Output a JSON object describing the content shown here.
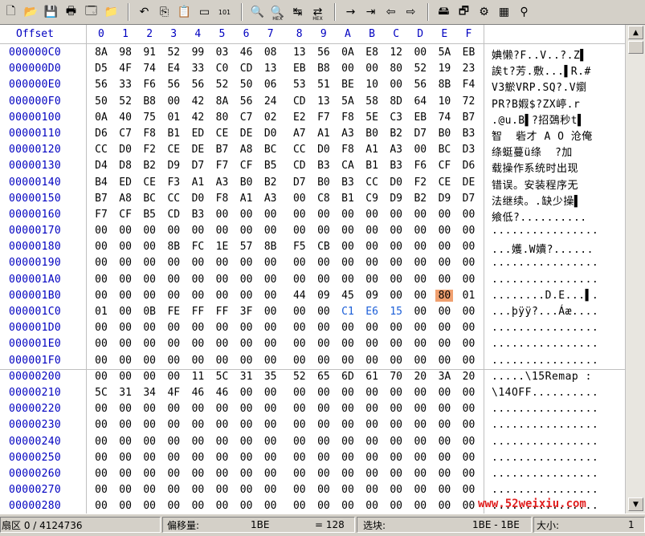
{
  "toolbar": {
    "buttons": [
      {
        "icon": "new-file-icon",
        "glyph": "🗋"
      },
      {
        "icon": "open-folder-icon",
        "glyph": "📂"
      },
      {
        "icon": "save-icon",
        "glyph": "💾"
      },
      {
        "icon": "print-icon",
        "glyph": "🖶"
      },
      {
        "icon": "properties-icon",
        "glyph": "🗔"
      },
      {
        "icon": "open-special-icon",
        "glyph": "📁"
      },
      {
        "icon": "undo-icon",
        "glyph": "↶"
      },
      {
        "icon": "copy-icon",
        "glyph": "⎘"
      },
      {
        "icon": "paste-icon",
        "glyph": "📋"
      },
      {
        "icon": "paste-disabled-icon",
        "glyph": "▭"
      },
      {
        "icon": "binary-icon",
        "glyph": "101"
      },
      {
        "icon": "find-icon",
        "glyph": "🔍"
      },
      {
        "icon": "find-hex-icon",
        "glyph": "🔍",
        "sub": "HEX"
      },
      {
        "icon": "replace-icon",
        "glyph": "↹"
      },
      {
        "icon": "replace-hex-icon",
        "glyph": "⇄",
        "sub": "HEX"
      },
      {
        "icon": "goto-icon",
        "glyph": "→"
      },
      {
        "icon": "goto-offset-icon",
        "glyph": "⇥"
      },
      {
        "icon": "back-icon",
        "glyph": "⇦"
      },
      {
        "icon": "forward-icon",
        "glyph": "⇨"
      },
      {
        "icon": "disk-icon",
        "glyph": "🖴"
      },
      {
        "icon": "windows-icon",
        "glyph": "🗗"
      },
      {
        "icon": "tools-icon",
        "glyph": "⚙"
      },
      {
        "icon": "calculator-icon",
        "glyph": "▦"
      },
      {
        "icon": "search-icon",
        "glyph": "⚲"
      }
    ]
  },
  "header": {
    "offset_label": "Offset",
    "columns": [
      "0",
      "1",
      "2",
      "3",
      "4",
      "5",
      "6",
      "7",
      "8",
      "9",
      "A",
      "B",
      "C",
      "D",
      "E",
      "F"
    ]
  },
  "rows": [
    {
      "offset": "000000C0",
      "bytes": [
        "8A",
        "98",
        "91",
        "52",
        "99",
        "03",
        "46",
        "08",
        "13",
        "56",
        "0A",
        "E8",
        "12",
        "00",
        "5A",
        "EB"
      ],
      "ascii": "婰懒?F..V..?.Z▌"
    },
    {
      "offset": "000000D0",
      "bytes": [
        "D5",
        "4F",
        "74",
        "E4",
        "33",
        "C0",
        "CD",
        "13",
        "EB",
        "B8",
        "00",
        "00",
        "80",
        "52",
        "19",
        "23"
      ],
      "ascii": "誒t?芳.敷...▌R.#"
    },
    {
      "offset": "000000E0",
      "bytes": [
        "56",
        "33",
        "F6",
        "56",
        "56",
        "52",
        "50",
        "06",
        "53",
        "51",
        "BE",
        "10",
        "00",
        "56",
        "8B",
        "F4"
      ],
      "ascii": "V3鯲VRP.SQ?.V嬼"
    },
    {
      "offset": "000000F0",
      "bytes": [
        "50",
        "52",
        "B8",
        "00",
        "42",
        "8A",
        "56",
        "24",
        "CD",
        "13",
        "5A",
        "58",
        "8D",
        "64",
        "10",
        "72"
      ],
      "ascii": "PR?B婽$?ZX嵉.r"
    },
    {
      "offset": "00000100",
      "bytes": [
        "0A",
        "40",
        "75",
        "01",
        "42",
        "80",
        "C7",
        "02",
        "E2",
        "F7",
        "F8",
        "5E",
        "C3",
        "EB",
        "74",
        "B7"
      ],
      "ascii": ".@u.B▌?招鵶秒t▌"
    },
    {
      "offset": "00000110",
      "bytes": [
        "D6",
        "C7",
        "F8",
        "B1",
        "ED",
        "CE",
        "DE",
        "D0",
        "A7",
        "A1",
        "A3",
        "B0",
        "B2",
        "D7",
        "B0",
        "B3"
      ],
      "ascii": "智  砦才 A O 沧俺"
    },
    {
      "offset": "00000120",
      "bytes": [
        "CC",
        "D0",
        "F2",
        "CE",
        "DE",
        "B7",
        "A8",
        "BC",
        "CC",
        "D0",
        "F8",
        "A1",
        "A3",
        "00",
        "BC",
        "D3"
      ],
      "ascii": "绦蜓蔓ü绦  ?加"
    },
    {
      "offset": "00000130",
      "bytes": [
        "D4",
        "D8",
        "B2",
        "D9",
        "D7",
        "F7",
        "CF",
        "B5",
        "CD",
        "B3",
        "CA",
        "B1",
        "B3",
        "F6",
        "CF",
        "D6"
      ],
      "ascii": "载操作系统时出现"
    },
    {
      "offset": "00000140",
      "bytes": [
        "B4",
        "ED",
        "CE",
        "F3",
        "A1",
        "A3",
        "B0",
        "B2",
        "D7",
        "B0",
        "B3",
        "CC",
        "D0",
        "F2",
        "CE",
        "DE"
      ],
      "ascii": "错误。安装程序无"
    },
    {
      "offset": "00000150",
      "bytes": [
        "B7",
        "A8",
        "BC",
        "CC",
        "D0",
        "F8",
        "A1",
        "A3",
        "00",
        "C8",
        "B1",
        "C9",
        "D9",
        "B2",
        "D9",
        "D7"
      ],
      "ascii": "法继续。.缺少操▌"
    },
    {
      "offset": "00000160",
      "bytes": [
        "F7",
        "CF",
        "B5",
        "CD",
        "B3",
        "00",
        "00",
        "00",
        "00",
        "00",
        "00",
        "00",
        "00",
        "00",
        "00",
        "00"
      ],
      "ascii": "飨低?.........."
    },
    {
      "offset": "00000170",
      "bytes": [
        "00",
        "00",
        "00",
        "00",
        "00",
        "00",
        "00",
        "00",
        "00",
        "00",
        "00",
        "00",
        "00",
        "00",
        "00",
        "00"
      ],
      "ascii": "................"
    },
    {
      "offset": "00000180",
      "bytes": [
        "00",
        "00",
        "00",
        "8B",
        "FC",
        "1E",
        "57",
        "8B",
        "F5",
        "CB",
        "00",
        "00",
        "00",
        "00",
        "00",
        "00"
      ],
      "ascii": "...嬳.W嬻?......"
    },
    {
      "offset": "00000190",
      "bytes": [
        "00",
        "00",
        "00",
        "00",
        "00",
        "00",
        "00",
        "00",
        "00",
        "00",
        "00",
        "00",
        "00",
        "00",
        "00",
        "00"
      ],
      "ascii": "................"
    },
    {
      "offset": "000001A0",
      "bytes": [
        "00",
        "00",
        "00",
        "00",
        "00",
        "00",
        "00",
        "00",
        "00",
        "00",
        "00",
        "00",
        "00",
        "00",
        "00",
        "00"
      ],
      "ascii": "................"
    },
    {
      "offset": "000001B0",
      "bytes": [
        "00",
        "00",
        "00",
        "00",
        "00",
        "00",
        "00",
        "00",
        "44",
        "09",
        "45",
        "09",
        "00",
        "00",
        "80",
        "01"
      ],
      "ascii": "........D.E...▌."
    },
    {
      "offset": "000001C0",
      "bytes": [
        "01",
        "00",
        "0B",
        "FE",
        "FF",
        "FF",
        "3F",
        "00",
        "00",
        "00",
        "C1",
        "E6",
        "15",
        "00",
        "00",
        "00"
      ],
      "ascii": "...þÿÿ?...Áæ...."
    },
    {
      "offset": "000001D0",
      "bytes": [
        "00",
        "00",
        "00",
        "00",
        "00",
        "00",
        "00",
        "00",
        "00",
        "00",
        "00",
        "00",
        "00",
        "00",
        "00",
        "00"
      ],
      "ascii": "................"
    },
    {
      "offset": "000001E0",
      "bytes": [
        "00",
        "00",
        "00",
        "00",
        "00",
        "00",
        "00",
        "00",
        "00",
        "00",
        "00",
        "00",
        "00",
        "00",
        "00",
        "00"
      ],
      "ascii": "................"
    },
    {
      "offset": "000001F0",
      "bytes": [
        "00",
        "00",
        "00",
        "00",
        "00",
        "00",
        "00",
        "00",
        "00",
        "00",
        "00",
        "00",
        "00",
        "00",
        "00",
        "00"
      ],
      "ascii": "................"
    },
    {
      "offset": "00000200",
      "bytes": [
        "00",
        "00",
        "00",
        "00",
        "11",
        "5C",
        "31",
        "35",
        "52",
        "65",
        "6D",
        "61",
        "70",
        "20",
        "3A",
        "20"
      ],
      "ascii": ".....\\15Remap : "
    },
    {
      "offset": "00000210",
      "bytes": [
        "5C",
        "31",
        "34",
        "4F",
        "46",
        "46",
        "00",
        "00",
        "00",
        "00",
        "00",
        "00",
        "00",
        "00",
        "00",
        "00"
      ],
      "ascii": "\\14OFF.........."
    },
    {
      "offset": "00000220",
      "bytes": [
        "00",
        "00",
        "00",
        "00",
        "00",
        "00",
        "00",
        "00",
        "00",
        "00",
        "00",
        "00",
        "00",
        "00",
        "00",
        "00"
      ],
      "ascii": "................"
    },
    {
      "offset": "00000230",
      "bytes": [
        "00",
        "00",
        "00",
        "00",
        "00",
        "00",
        "00",
        "00",
        "00",
        "00",
        "00",
        "00",
        "00",
        "00",
        "00",
        "00"
      ],
      "ascii": "................"
    },
    {
      "offset": "00000240",
      "bytes": [
        "00",
        "00",
        "00",
        "00",
        "00",
        "00",
        "00",
        "00",
        "00",
        "00",
        "00",
        "00",
        "00",
        "00",
        "00",
        "00"
      ],
      "ascii": "................"
    },
    {
      "offset": "00000250",
      "bytes": [
        "00",
        "00",
        "00",
        "00",
        "00",
        "00",
        "00",
        "00",
        "00",
        "00",
        "00",
        "00",
        "00",
        "00",
        "00",
        "00"
      ],
      "ascii": "................"
    },
    {
      "offset": "00000260",
      "bytes": [
        "00",
        "00",
        "00",
        "00",
        "00",
        "00",
        "00",
        "00",
        "00",
        "00",
        "00",
        "00",
        "00",
        "00",
        "00",
        "00"
      ],
      "ascii": "................"
    },
    {
      "offset": "00000270",
      "bytes": [
        "00",
        "00",
        "00",
        "00",
        "00",
        "00",
        "00",
        "00",
        "00",
        "00",
        "00",
        "00",
        "00",
        "00",
        "00",
        "00"
      ],
      "ascii": "................"
    },
    {
      "offset": "00000280",
      "bytes": [
        "00",
        "00",
        "00",
        "00",
        "00",
        "00",
        "00",
        "00",
        "00",
        "00",
        "00",
        "00",
        "00",
        "00",
        "00",
        "00"
      ],
      "ascii": "................"
    }
  ],
  "highlight": {
    "row": "000001B0",
    "col": 14,
    "color": "#f0a070"
  },
  "blue_bytes": {
    "row": "000001C0",
    "cols": [
      10,
      11,
      12
    ],
    "color": "#1c5fd8"
  },
  "watermark": "www.52weixiu.com",
  "status": {
    "sector": "扇区 0 / 4124736",
    "offset_label": "偏移量:",
    "offset_value": "1BE",
    "equals_value": "= 128",
    "selection_label": "选块:",
    "selection_value": "1BE - 1BE",
    "size_label": "大小:",
    "size_value": "1"
  },
  "colors": {
    "offset_blue": "#0000c0",
    "background": "#d4d0c8"
  }
}
